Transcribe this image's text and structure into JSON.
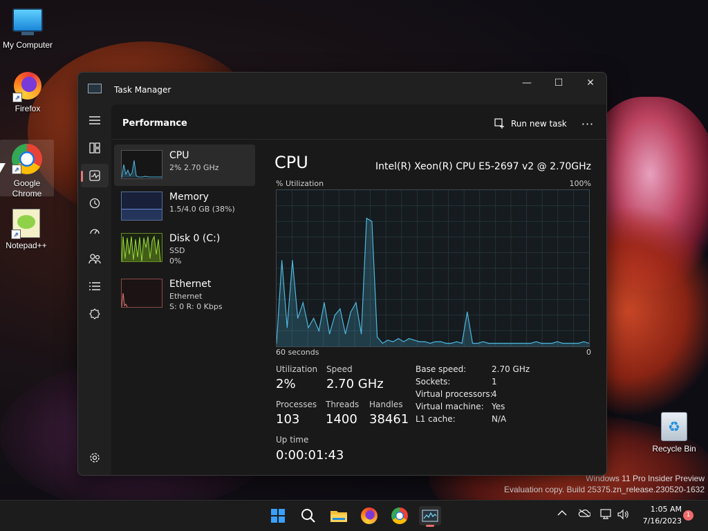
{
  "desktop": {
    "icons": [
      {
        "label": "My Computer"
      },
      {
        "label": "Firefox"
      },
      {
        "label": "Google Chrome"
      },
      {
        "label": "Notepad++"
      },
      {
        "label": "Recycle Bin"
      }
    ],
    "watermark": {
      "line1": "Windows 11 Pro Insider Preview",
      "line2": "Evaluation copy. Build 25375.zn_release.230520-1632"
    }
  },
  "window": {
    "title": "Task Manager",
    "controls": {
      "minimize": "—",
      "maximize": "☐",
      "close": "✕"
    }
  },
  "nav": {
    "items": [
      {
        "icon": "hamburger-icon"
      },
      {
        "icon": "processes-icon"
      },
      {
        "icon": "performance-icon",
        "active": true
      },
      {
        "icon": "app-history-icon"
      },
      {
        "icon": "startup-apps-icon"
      },
      {
        "icon": "users-icon"
      },
      {
        "icon": "details-icon"
      },
      {
        "icon": "services-icon"
      },
      {
        "icon": "settings-icon"
      }
    ]
  },
  "header": {
    "title": "Performance",
    "run_new_task": "Run new task",
    "more": "···"
  },
  "resources": [
    {
      "name": "CPU",
      "sub1": "2% 2.70 GHz",
      "sub2": ""
    },
    {
      "name": "Memory",
      "sub1": "1.5/4.0 GB (38%)",
      "sub2": ""
    },
    {
      "name": "Disk 0 (C:)",
      "sub1": "SSD",
      "sub2": "0%"
    },
    {
      "name": "Ethernet",
      "sub1": "Ethernet",
      "sub2": "S: 0 R: 0 Kbps"
    }
  ],
  "detail": {
    "title": "CPU",
    "model": "Intel(R) Xeon(R) CPU E5-2697 v2 @ 2.70GHz",
    "graph_label": "% Utilization",
    "graph_max": "100%",
    "graph_time": "60 seconds",
    "graph_min": "0",
    "stats": {
      "utilization_label": "Utilization",
      "utilization": "2%",
      "speed_label": "Speed",
      "speed": "2.70 GHz",
      "processes_label": "Processes",
      "processes": "103",
      "threads_label": "Threads",
      "threads": "1400",
      "handles_label": "Handles",
      "handles": "38461",
      "uptime_label": "Up time",
      "uptime": "0:00:01:43"
    },
    "specs": [
      {
        "k": "Base speed:",
        "v": "2.70 GHz"
      },
      {
        "k": "Sockets:",
        "v": "1"
      },
      {
        "k": "Virtual processors:",
        "v": "4"
      },
      {
        "k": "Virtual machine:",
        "v": "Yes"
      },
      {
        "k": "L1 cache:",
        "v": "N/A"
      }
    ]
  },
  "chart_data": {
    "type": "area",
    "xlabel": "60 seconds",
    "ylabel": "% Utilization",
    "ylim": [
      0,
      100
    ],
    "values": [
      2,
      55,
      12,
      55,
      18,
      28,
      12,
      18,
      10,
      28,
      8,
      20,
      24,
      8,
      22,
      28,
      8,
      82,
      80,
      6,
      2,
      4,
      3,
      5,
      3,
      5,
      4,
      3,
      3,
      2,
      3,
      3,
      2,
      2,
      3,
      2,
      22,
      2,
      2,
      3,
      2,
      2,
      2,
      2,
      2,
      2,
      2,
      2,
      2,
      3,
      2,
      2,
      2,
      3,
      2,
      2,
      2,
      2,
      3,
      2
    ],
    "accent": "#4fb8e0"
  },
  "taskbar": {
    "clock_time": "1:05 AM",
    "clock_date": "7/16/2023",
    "notif_count": "1",
    "items": [
      "start-icon",
      "search-icon",
      "file-explorer-icon",
      "firefox-icon",
      "chrome-icon",
      "task-manager-icon"
    ]
  }
}
